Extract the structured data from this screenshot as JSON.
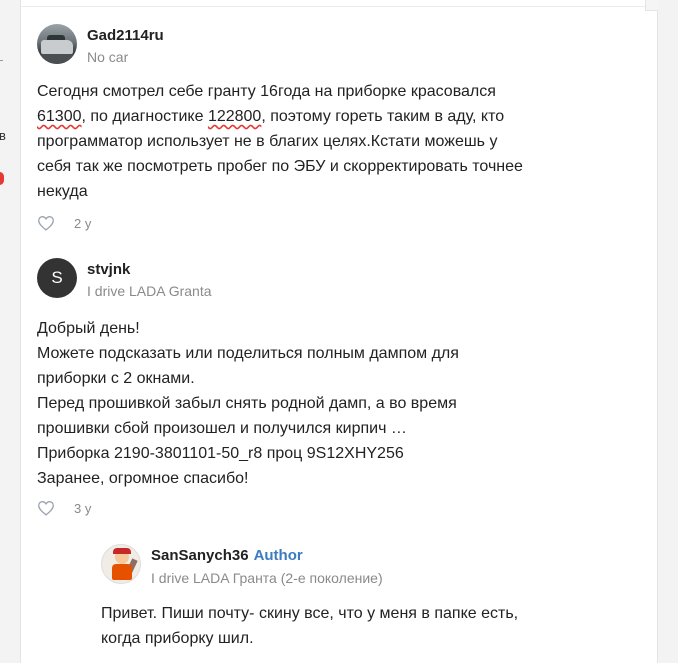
{
  "edge": {
    "fragment_text": "в"
  },
  "comments": [
    {
      "username": "Gad2114ru",
      "subline": "No car",
      "text_before_1": "Сегодня смотрел себе гранту 16года на приборке красовался ",
      "highlight_1": "61300",
      "text_between": ", по диагностике ",
      "highlight_2": "122800",
      "text_after": ", поэтому гореть таким в аду, кто программатор использует не в благих целях.Кстати можешь у себя так же посмотреть пробег по ЭБУ и скорректировать точнее некуда",
      "age": "2 y"
    },
    {
      "username": "stvjnk",
      "avatar_letter": "S",
      "subline": "I drive LADA Granta",
      "text": "Добрый день!\nМожете подсказать или поделиться полным дампом для приборки с 2 окнами.\nПеред прошивкой забыл снять родной дамп, а во время прошивки сбой произошел и получился кирпич …\nПриборка 2190-3801101-50_r8 проц 9S12XHY256\nЗаранее, огромное спасибо!",
      "age": "3 y"
    },
    {
      "username": "SanSanych36",
      "badge": "Author",
      "subline": "I drive LADA Гранта (2-е поколение)",
      "text": "Привет. Пиши почту- скину все, что у меня в папке есть, когда приборку шил."
    }
  ],
  "colors": {
    "accent": "#3c7bbf",
    "highlight_underline": "#e53935",
    "muted": "#8a8a8a"
  },
  "icons": {
    "like": "heart-outline-icon"
  }
}
